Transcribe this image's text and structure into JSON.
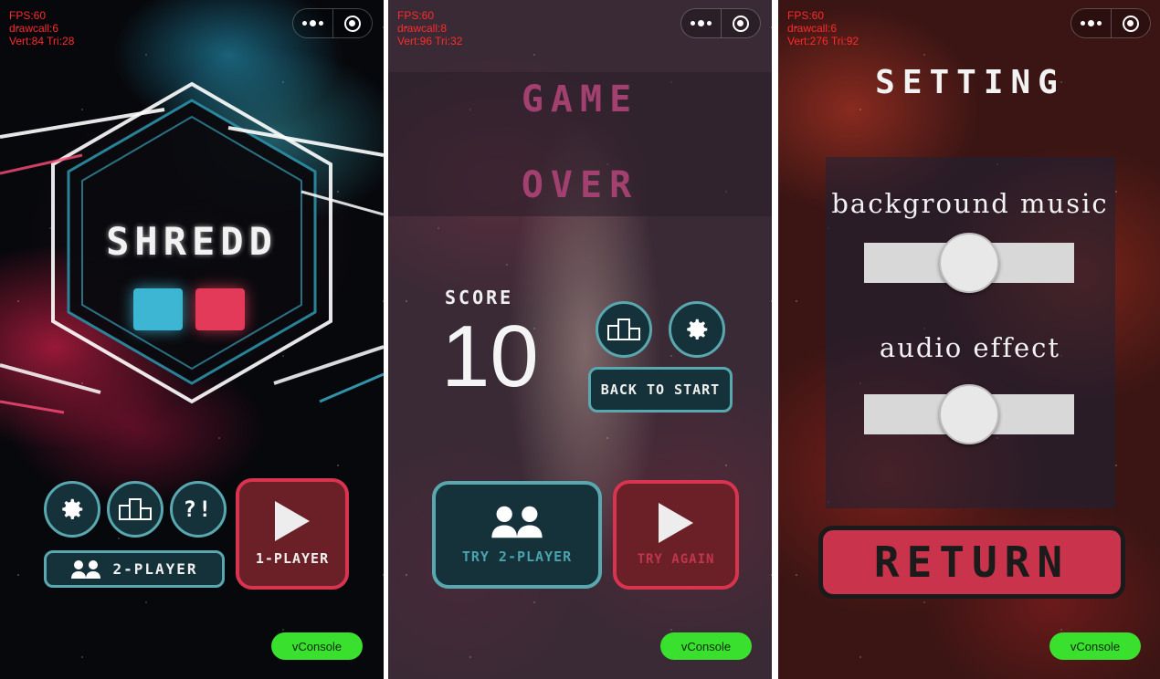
{
  "debug_screens": [
    {
      "fps": "FPS:60",
      "drawcall": "drawcall:6",
      "verts": "Vert:84 Tri:28"
    },
    {
      "fps": "FPS:60",
      "drawcall": "drawcall:8",
      "verts": "Vert:96 Tri:32"
    },
    {
      "fps": "FPS:60",
      "drawcall": "drawcall:6",
      "verts": "Vert:276 Tri:92"
    }
  ],
  "vconsole_label": "vConsole",
  "menu": {
    "logo_title": "SHREDD",
    "two_player_label": "2-PLAYER",
    "one_player_label": "1-PLAYER",
    "help_label": "?!",
    "icons": [
      "gear-icon",
      "podium-icon",
      "help-icon",
      "two-users-icon",
      "play-icon"
    ]
  },
  "game_over": {
    "title_line1": "GAME",
    "title_line2": "OVER",
    "score_label": "SCORE",
    "score_value": "10",
    "back_to_start_label": "BACK TO START",
    "try_two_player_label": "TRY 2-PLAYER",
    "try_again_label": "TRY AGAIN"
  },
  "settings": {
    "title": "SETTING",
    "background_music_label": "background music",
    "audio_effect_label": "audio effect",
    "background_music_level": 0.5,
    "audio_effect_level": 0.5,
    "return_label": "RETURN"
  },
  "colors": {
    "teal_button": "#15323a",
    "teal_border": "#59a8b0",
    "red_button": "#6a2026",
    "red_border": "#d8334f",
    "logo_blue": "#3cb6d2",
    "logo_red": "#e23a58",
    "game_over_text": "#a2406f",
    "return_button": "#c9334b",
    "vconsole": "#39e02d"
  }
}
